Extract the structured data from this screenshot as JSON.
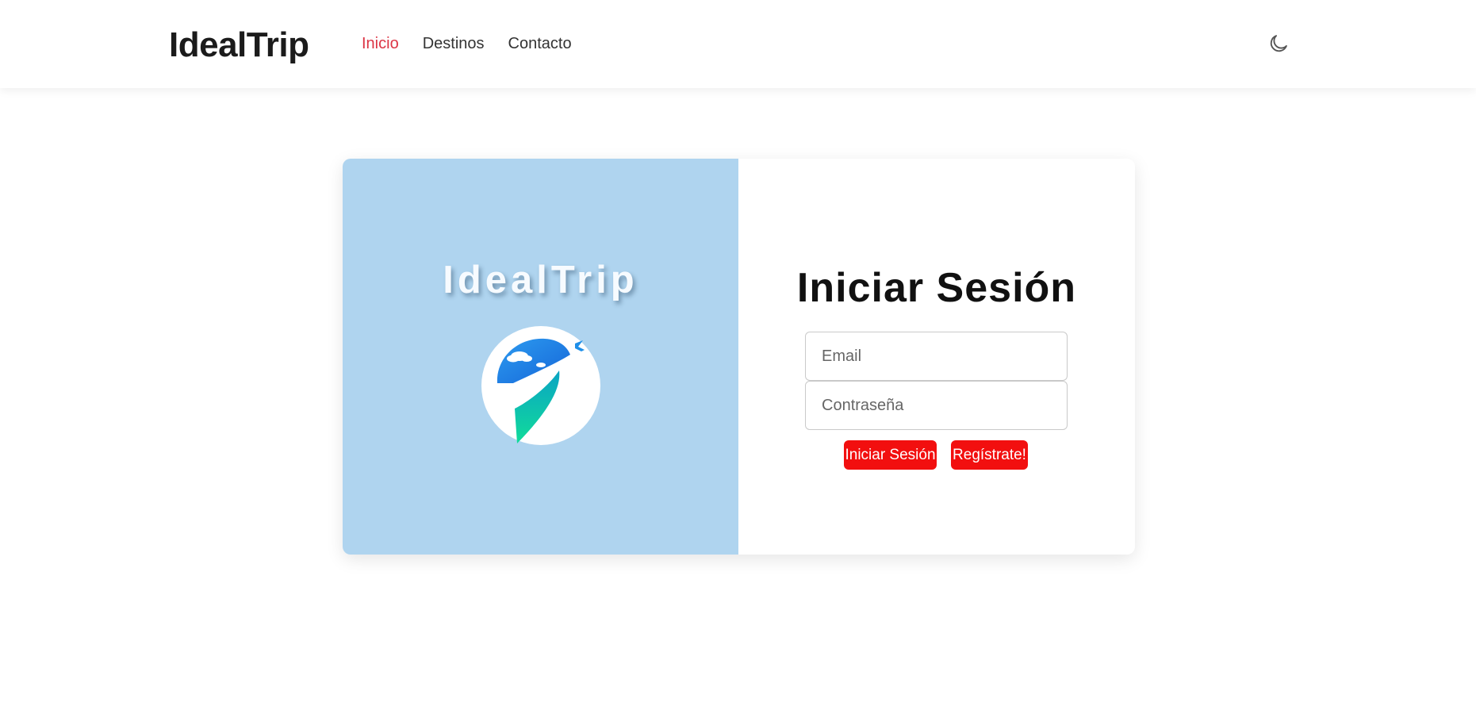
{
  "header": {
    "brand": "IdealTrip",
    "nav": [
      {
        "label": "Inicio",
        "active": true
      },
      {
        "label": "Destinos",
        "active": false
      },
      {
        "label": "Contacto",
        "active": false
      }
    ],
    "theme_toggle_icon": "moon-icon"
  },
  "hero": {
    "title": "IdealTrip",
    "background_color": "#afd4ef",
    "logo_icon": "location-pin-plane-icon"
  },
  "login": {
    "title": "Iniciar Sesión",
    "email_placeholder": "Email",
    "password_placeholder": "Contraseña",
    "login_button": "Iniciar Sesión",
    "register_button": "Regístrate!",
    "button_color": "#f20f0f"
  },
  "colors": {
    "accent_active_nav": "#dc3545"
  }
}
